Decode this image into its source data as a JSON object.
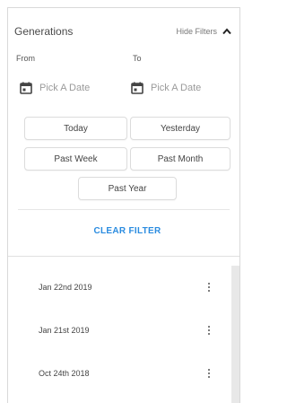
{
  "header": {
    "title": "Generations",
    "hide_filters_label": "Hide Filters"
  },
  "filters": {
    "from_label": "From",
    "to_label": "To",
    "from_placeholder": "Pick A Date",
    "to_placeholder": "Pick A Date",
    "quick_ranges": [
      "Today",
      "Yesterday",
      "Past Week",
      "Past Month",
      "Past Year"
    ],
    "clear_label": "CLEAR FILTER"
  },
  "list": {
    "items": [
      {
        "date": "Jan 22nd 2019"
      },
      {
        "date": "Jan 21st 2019"
      },
      {
        "date": "Oct 24th 2018"
      }
    ]
  },
  "colors": {
    "accent": "#2b8ce0"
  },
  "icons": {
    "calendar": "calendar-icon",
    "chevron": "chevron-up-icon",
    "more": "more-vertical-icon"
  }
}
